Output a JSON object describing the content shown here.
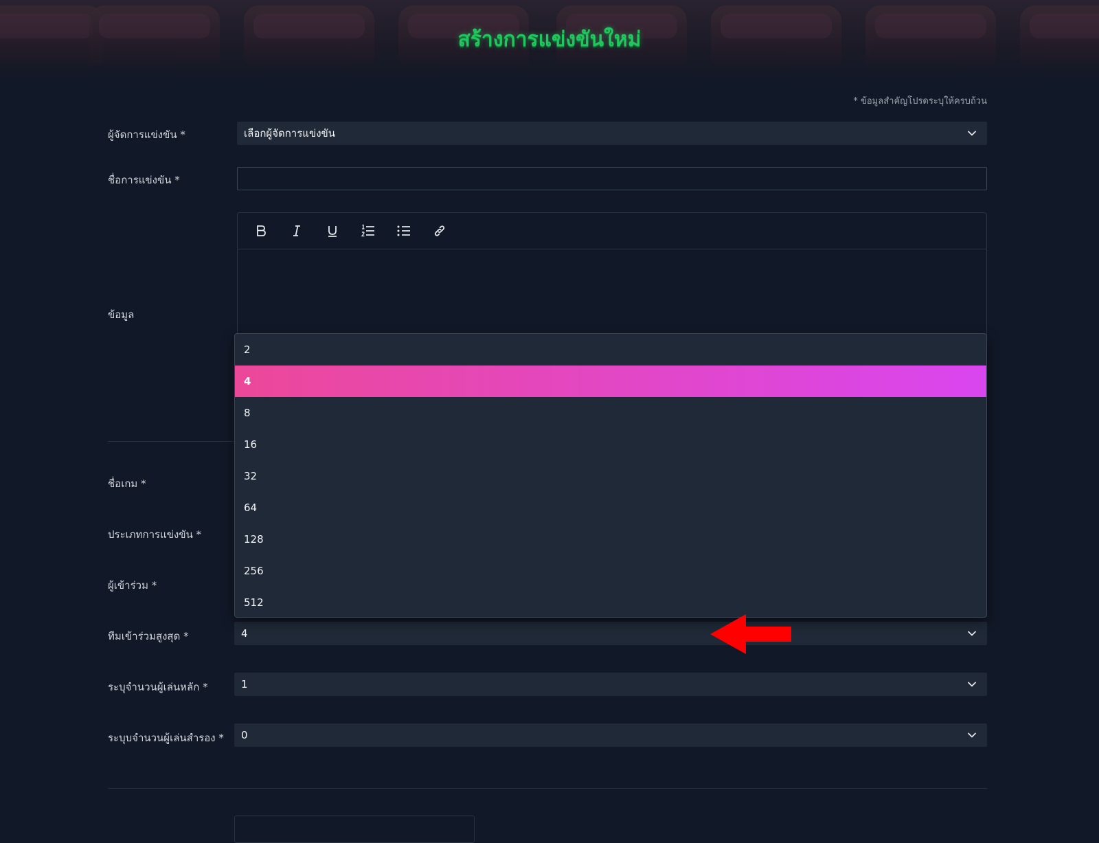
{
  "header": {
    "title": "สร้างการแข่งขันใหม่"
  },
  "form": {
    "required_note": "* ข้อมูลสำคัญโปรดระบุให้ครบถ้วน",
    "organizer": {
      "label": "ผู้จัดการแข่งขัน *",
      "value": "เลือกผู้จัดการแข่งขัน"
    },
    "name": {
      "label": "ชื่อการแข่งขัน *",
      "value": ""
    },
    "info": {
      "label": "ข้อมูล"
    },
    "game": {
      "label": "ชื่อเกม *"
    },
    "type": {
      "label": "ประเภทการแข่งขัน *"
    },
    "participants": {
      "label": "ผู้เข้าร่วม *"
    },
    "max_teams": {
      "label": "ทีมเข้าร่วมสูงสุด *",
      "value": "4"
    },
    "main_players": {
      "label": "ระบุจำนวนผู้เล่นหลัก *",
      "value": "1"
    },
    "sub_players": {
      "label": "ระบุบจำนวนผู้เล่นสำรอง *",
      "value": "0"
    }
  },
  "editor_toolbar": {
    "buttons": [
      {
        "icon": "bold-icon"
      },
      {
        "icon": "italic-icon"
      },
      {
        "icon": "underline-icon"
      },
      {
        "icon": "ordered-list-icon"
      },
      {
        "icon": "bullet-list-icon"
      },
      {
        "icon": "link-icon"
      }
    ]
  },
  "dropdown": {
    "options": [
      "2",
      "4",
      "8",
      "16",
      "32",
      "64",
      "128",
      "256",
      "512"
    ],
    "selected": "4"
  },
  "colors": {
    "accent_gradient_start": "#ec4899",
    "accent_gradient_end": "#d946ef",
    "title_green": "#22c55e",
    "annotation_arrow": "#ff0000"
  }
}
